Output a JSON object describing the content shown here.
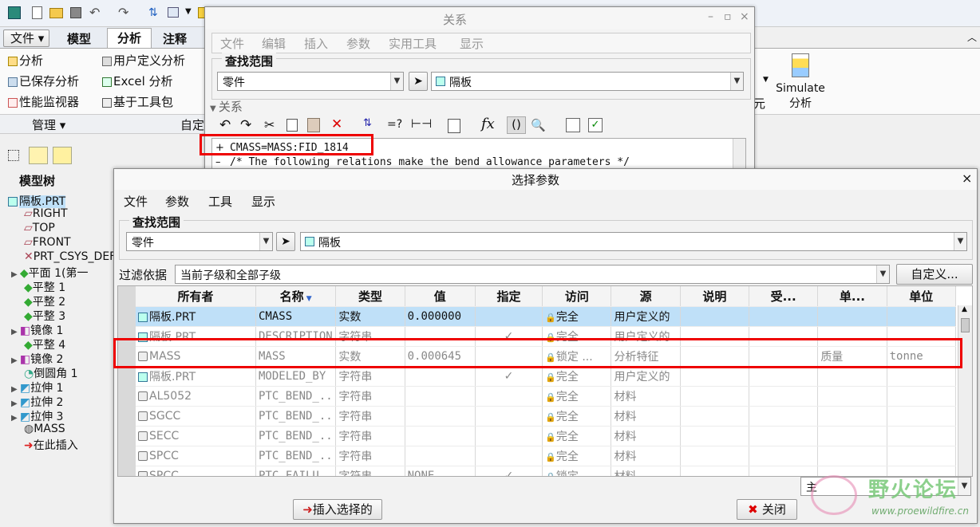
{
  "quick_access": {
    "items": [
      "new-icon",
      "open-icon",
      "save-icon",
      "undo-icon",
      "redo-icon",
      "regen-icon",
      "windows-icon"
    ]
  },
  "ribbon": {
    "tabs": [
      "文件",
      "模型",
      "分析",
      "注释"
    ],
    "active_tab": "分析",
    "col1": [
      "分析",
      "已保存分析",
      "性能监视器"
    ],
    "col2": [
      "用户定义分析",
      "Excel 分析",
      "基于工具包"
    ],
    "group_manage": "管理",
    "group_custom": "自定",
    "right_fragment": "元",
    "simulate_line1": "Simulate",
    "simulate_line2": "分析"
  },
  "left_tabs": [
    "tree-icon",
    "layer-icon",
    "folder-icon"
  ],
  "model_tree": {
    "title": "模型树",
    "items": [
      {
        "label": "隔板.PRT",
        "indent": 0,
        "expand": ""
      },
      {
        "label": "RIGHT",
        "indent": 1,
        "expand": ""
      },
      {
        "label": "TOP",
        "indent": 1,
        "expand": ""
      },
      {
        "label": "FRONT",
        "indent": 1,
        "expand": ""
      },
      {
        "label": "PRT_CSYS_DEF",
        "indent": 1,
        "expand": ""
      },
      {
        "label": "平面 1(第一",
        "indent": 1,
        "expand": "▸"
      },
      {
        "label": "平整 1",
        "indent": 1,
        "expand": ""
      },
      {
        "label": "平整 2",
        "indent": 1,
        "expand": ""
      },
      {
        "label": "平整 3",
        "indent": 1,
        "expand": ""
      },
      {
        "label": "镜像 1",
        "indent": 1,
        "expand": "▸"
      },
      {
        "label": "平整 4",
        "indent": 1,
        "expand": ""
      },
      {
        "label": "镜像 2",
        "indent": 1,
        "expand": "▸"
      },
      {
        "label": "倒圆角 1",
        "indent": 1,
        "expand": ""
      },
      {
        "label": "拉伸 1",
        "indent": 1,
        "expand": "▸"
      },
      {
        "label": "拉伸 2",
        "indent": 1,
        "expand": "▸"
      },
      {
        "label": "拉伸 3",
        "indent": 1,
        "expand": "▸"
      },
      {
        "label": "MASS",
        "indent": 1,
        "expand": ""
      },
      {
        "label": "在此插入",
        "indent": 1,
        "expand": ""
      }
    ]
  },
  "relations": {
    "title": "关系",
    "menu": [
      "文件",
      "编辑",
      "插入",
      "参数",
      "实用工具",
      "显示"
    ],
    "scope_label": "查找范围",
    "scope_type": "零件",
    "scope_value": "隔板",
    "section_label": "关系",
    "line1": "CMASS=MASS:FID_1814",
    "line2": "/* The following relations make the bend allowance parameters      */"
  },
  "select_params": {
    "title": "选择参数",
    "menu": [
      "文件",
      "参数",
      "工具",
      "显示"
    ],
    "scope_label": "查找范围",
    "scope_type": "零件",
    "scope_value": "隔板",
    "filter_label": "过滤依据",
    "filter_value": "当前子级和全部子级",
    "custom_button": "自定义...",
    "columns": [
      "所有者",
      "名称",
      "类型",
      "值",
      "指定",
      "访问",
      "源",
      "说明",
      "受...",
      "单...",
      "单位"
    ],
    "rows": [
      {
        "owner": "隔板.PRT",
        "name": "CMASS",
        "type": "实数",
        "value": "0.000000",
        "designated": "",
        "access": "完全",
        "source": "用户定义的",
        "unit_q": "",
        "unit": "",
        "style": "selected"
      },
      {
        "owner": "隔板.PRT",
        "name": "DESCRIPTION",
        "type": "字符串",
        "value": "",
        "designated": "✓",
        "access": "完全",
        "source": "用户定义的",
        "unit_q": "",
        "unit": "",
        "style": "gray"
      },
      {
        "owner": "MASS",
        "name": "MASS",
        "type": "实数",
        "value": "0.000645",
        "designated": "",
        "access": "锁定 ...",
        "source": "分析特征",
        "unit_q": "质量",
        "unit": "tonne",
        "style": "gray"
      },
      {
        "owner": "隔板.PRT",
        "name": "MODELED_BY",
        "type": "字符串",
        "value": "",
        "designated": "✓",
        "access": "完全",
        "source": "用户定义的",
        "unit_q": "",
        "unit": "",
        "style": "gray"
      },
      {
        "owner": "AL5052",
        "name": "PTC_BEND_...",
        "type": "字符串",
        "value": "",
        "designated": "",
        "access": "完全",
        "source": "材料",
        "unit_q": "",
        "unit": "",
        "style": "gray"
      },
      {
        "owner": "SGCC",
        "name": "PTC_BEND_...",
        "type": "字符串",
        "value": "",
        "designated": "",
        "access": "完全",
        "source": "材料",
        "unit_q": "",
        "unit": "",
        "style": "gray"
      },
      {
        "owner": "SECC",
        "name": "PTC_BEND_...",
        "type": "字符串",
        "value": "",
        "designated": "",
        "access": "完全",
        "source": "材料",
        "unit_q": "",
        "unit": "",
        "style": "gray"
      },
      {
        "owner": "SPCC",
        "name": "PTC_BEND_...",
        "type": "字符串",
        "value": "",
        "designated": "",
        "access": "完全",
        "source": "材料",
        "unit_q": "",
        "unit": "",
        "style": "gray"
      },
      {
        "owner": "SPCC",
        "name": "PTC_FAILU...",
        "type": "字符串",
        "value": "NONE",
        "designated": "✓",
        "access": "锁定",
        "source": "材料",
        "unit_q": "",
        "unit": "",
        "style": "gray"
      }
    ],
    "insert_button": "插入选择的",
    "close_button": "关闭",
    "bottom_right_combo": "主"
  },
  "watermark": {
    "title": "野火论坛",
    "url": "www.proewildfire.cn"
  },
  "colors": {
    "selected_row": "#bfe0f8",
    "highlight": "#e00000",
    "accent": "#c62f2f"
  }
}
